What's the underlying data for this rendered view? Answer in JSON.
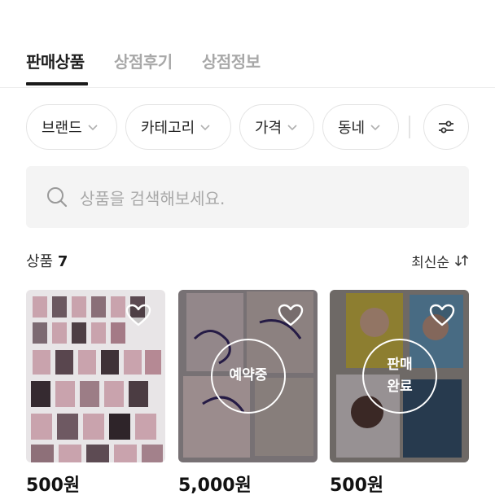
{
  "tabs": [
    {
      "label": "판매상품",
      "active": true
    },
    {
      "label": "상점후기",
      "active": false
    },
    {
      "label": "상점정보",
      "active": false
    }
  ],
  "filters": {
    "chips": [
      "브랜드",
      "카테고리",
      "가격",
      "동네"
    ],
    "settings_icon": "sliders-icon"
  },
  "search": {
    "placeholder": "상품을 검색해보세요."
  },
  "list": {
    "count_label": "상품",
    "count": "7",
    "sort_label": "최신순"
  },
  "products": [
    {
      "price": "500원",
      "status": ""
    },
    {
      "price": "5,000원",
      "status": "예약중"
    },
    {
      "price": "500원",
      "status": "판매\n완료"
    }
  ],
  "colors": {
    "active_tab": "#1a1a1a",
    "inactive_tab": "#a8a8a8",
    "chip_border": "#e4e4e4",
    "search_bg": "#f4f4f4"
  }
}
